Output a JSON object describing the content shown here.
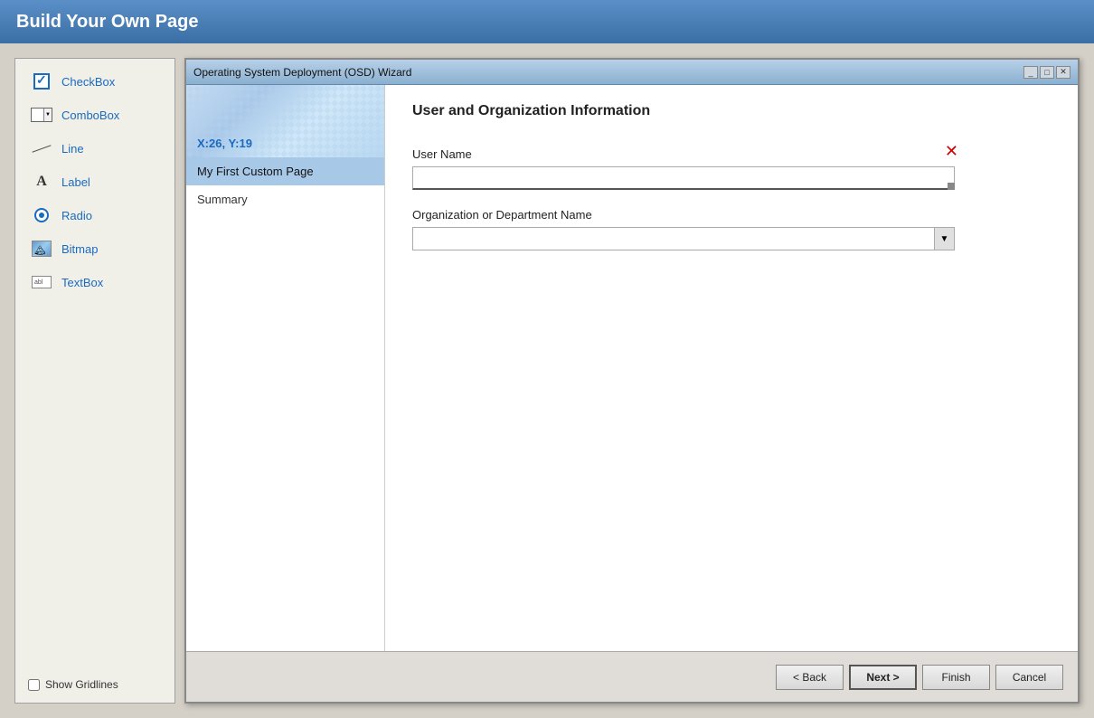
{
  "app": {
    "title": "Build Your Own Page"
  },
  "toolbox": {
    "items": [
      {
        "id": "checkbox",
        "label": "CheckBox",
        "icon": "checkbox-icon"
      },
      {
        "id": "combobox",
        "label": "ComboBox",
        "icon": "combobox-icon"
      },
      {
        "id": "line",
        "label": "Line",
        "icon": "line-icon"
      },
      {
        "id": "label",
        "label": "Label",
        "icon": "label-icon"
      },
      {
        "id": "radio",
        "label": "Radio",
        "icon": "radio-icon"
      },
      {
        "id": "bitmap",
        "label": "Bitmap",
        "icon": "bitmap-icon"
      },
      {
        "id": "textbox",
        "label": "TextBox",
        "icon": "textbox-icon"
      }
    ],
    "show_gridlines_label": "Show Gridlines"
  },
  "wizard": {
    "title": "Operating System Deployment (OSD) Wizard",
    "window_controls": [
      "_",
      "□",
      "✕"
    ],
    "coord_label": "X:26, Y:19",
    "nav_items": [
      {
        "id": "my-first-custom-page",
        "label": "My First Custom Page",
        "active": true
      },
      {
        "id": "summary",
        "label": "Summary",
        "active": false
      }
    ],
    "content": {
      "title": "User and Organization Information",
      "fields": [
        {
          "id": "user-name",
          "label": "User Name",
          "type": "text",
          "required": true,
          "value": ""
        },
        {
          "id": "org-name",
          "label": "Organization or Department Name",
          "type": "combo",
          "required": false,
          "value": ""
        }
      ]
    },
    "footer": {
      "buttons": [
        {
          "id": "back",
          "label": "< Back"
        },
        {
          "id": "next",
          "label": "Next >"
        },
        {
          "id": "finish",
          "label": "Finish"
        },
        {
          "id": "cancel",
          "label": "Cancel"
        }
      ]
    }
  }
}
